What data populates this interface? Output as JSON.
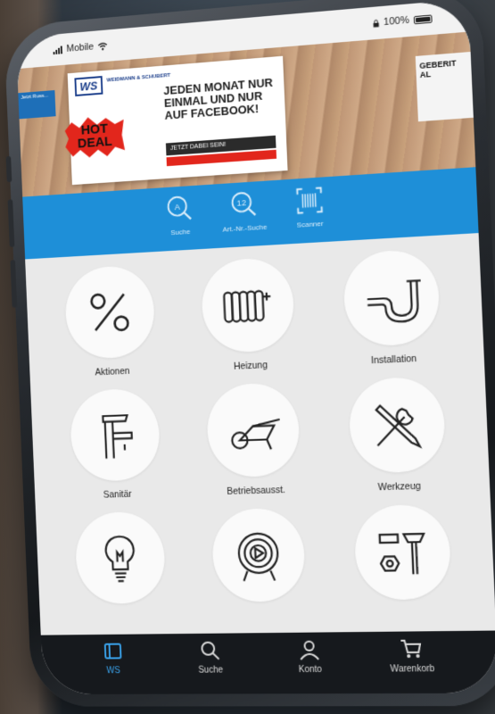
{
  "status_bar": {
    "carrier": "Mobile",
    "battery": "100%"
  },
  "banner": {
    "logo": "WS",
    "brand": "WEIDMANN & SCHUBERT",
    "headline": "JEDEN MONAT NUR EINMAL UND NUR AUF FACEBOOK!",
    "badge": "HOT DEAL",
    "cta": "JETZT DABEI SEIN!",
    "side_text": "GEBERIT AL",
    "left_text": "Jetzt Russ..."
  },
  "quick_actions": [
    {
      "label": "Suche",
      "icon": "search-text-icon"
    },
    {
      "label": "Art.-Nr.-Suche",
      "icon": "search-number-icon"
    },
    {
      "label": "Scanner",
      "icon": "barcode-scanner-icon"
    }
  ],
  "categories": [
    {
      "label": "Aktionen",
      "icon": "percent-icon"
    },
    {
      "label": "Heizung",
      "icon": "radiator-icon"
    },
    {
      "label": "Installation",
      "icon": "pipe-icon"
    },
    {
      "label": "Sanitär",
      "icon": "faucet-icon"
    },
    {
      "label": "Betriebsausst.",
      "icon": "wheelbarrow-icon"
    },
    {
      "label": "Werkzeug",
      "icon": "wrench-screwdriver-icon"
    },
    {
      "label": "",
      "icon": "lightbulb-icon"
    },
    {
      "label": "",
      "icon": "cable-reel-icon"
    },
    {
      "label": "",
      "icon": "fasteners-icon"
    }
  ],
  "tab_bar": [
    {
      "label": "WS",
      "icon": "ws-home-icon",
      "active": true
    },
    {
      "label": "Suche",
      "icon": "search-icon",
      "active": false
    },
    {
      "label": "Konto",
      "icon": "user-icon",
      "active": false
    },
    {
      "label": "Warenkorb",
      "icon": "cart-icon",
      "active": false
    }
  ],
  "colors": {
    "accent_blue": "#1e8fd8",
    "tab_active": "#3aa3ec",
    "tab_bar_bg": "#16191d",
    "hot_deal_red": "#e2261c"
  }
}
